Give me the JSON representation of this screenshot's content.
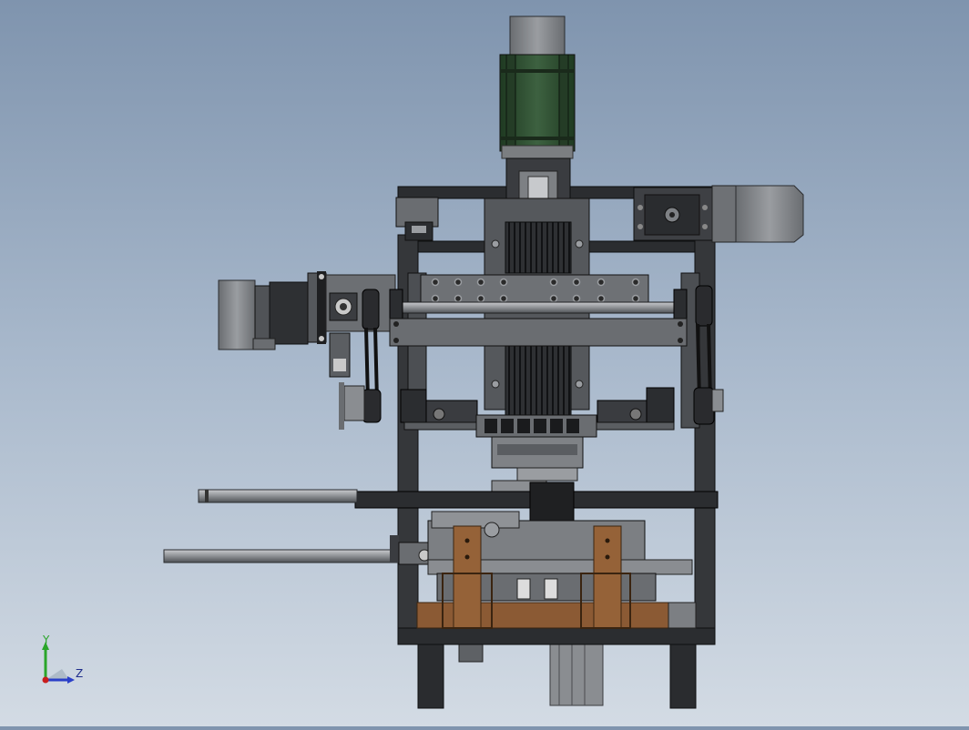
{
  "view": {
    "background_top": "#7f94ae",
    "background_bottom": "#d3dbe4"
  },
  "triad": {
    "y_label": "Y",
    "z_label": "Z",
    "y_color": "#2aa52a",
    "z_color": "#2a3fc8",
    "origin_color": "#c81e1e",
    "icon": "coordinate-triad-icon"
  },
  "colors": {
    "frame": "#2b2d30",
    "frame_dark": "#1c1d1f",
    "plate": "#6b6e72",
    "plate_light": "#8c8f93",
    "motor_body": "#2d4a2e",
    "motor_cap": "#7b7e81",
    "wood": "#8b5a34",
    "rod": "#8a8d91"
  }
}
